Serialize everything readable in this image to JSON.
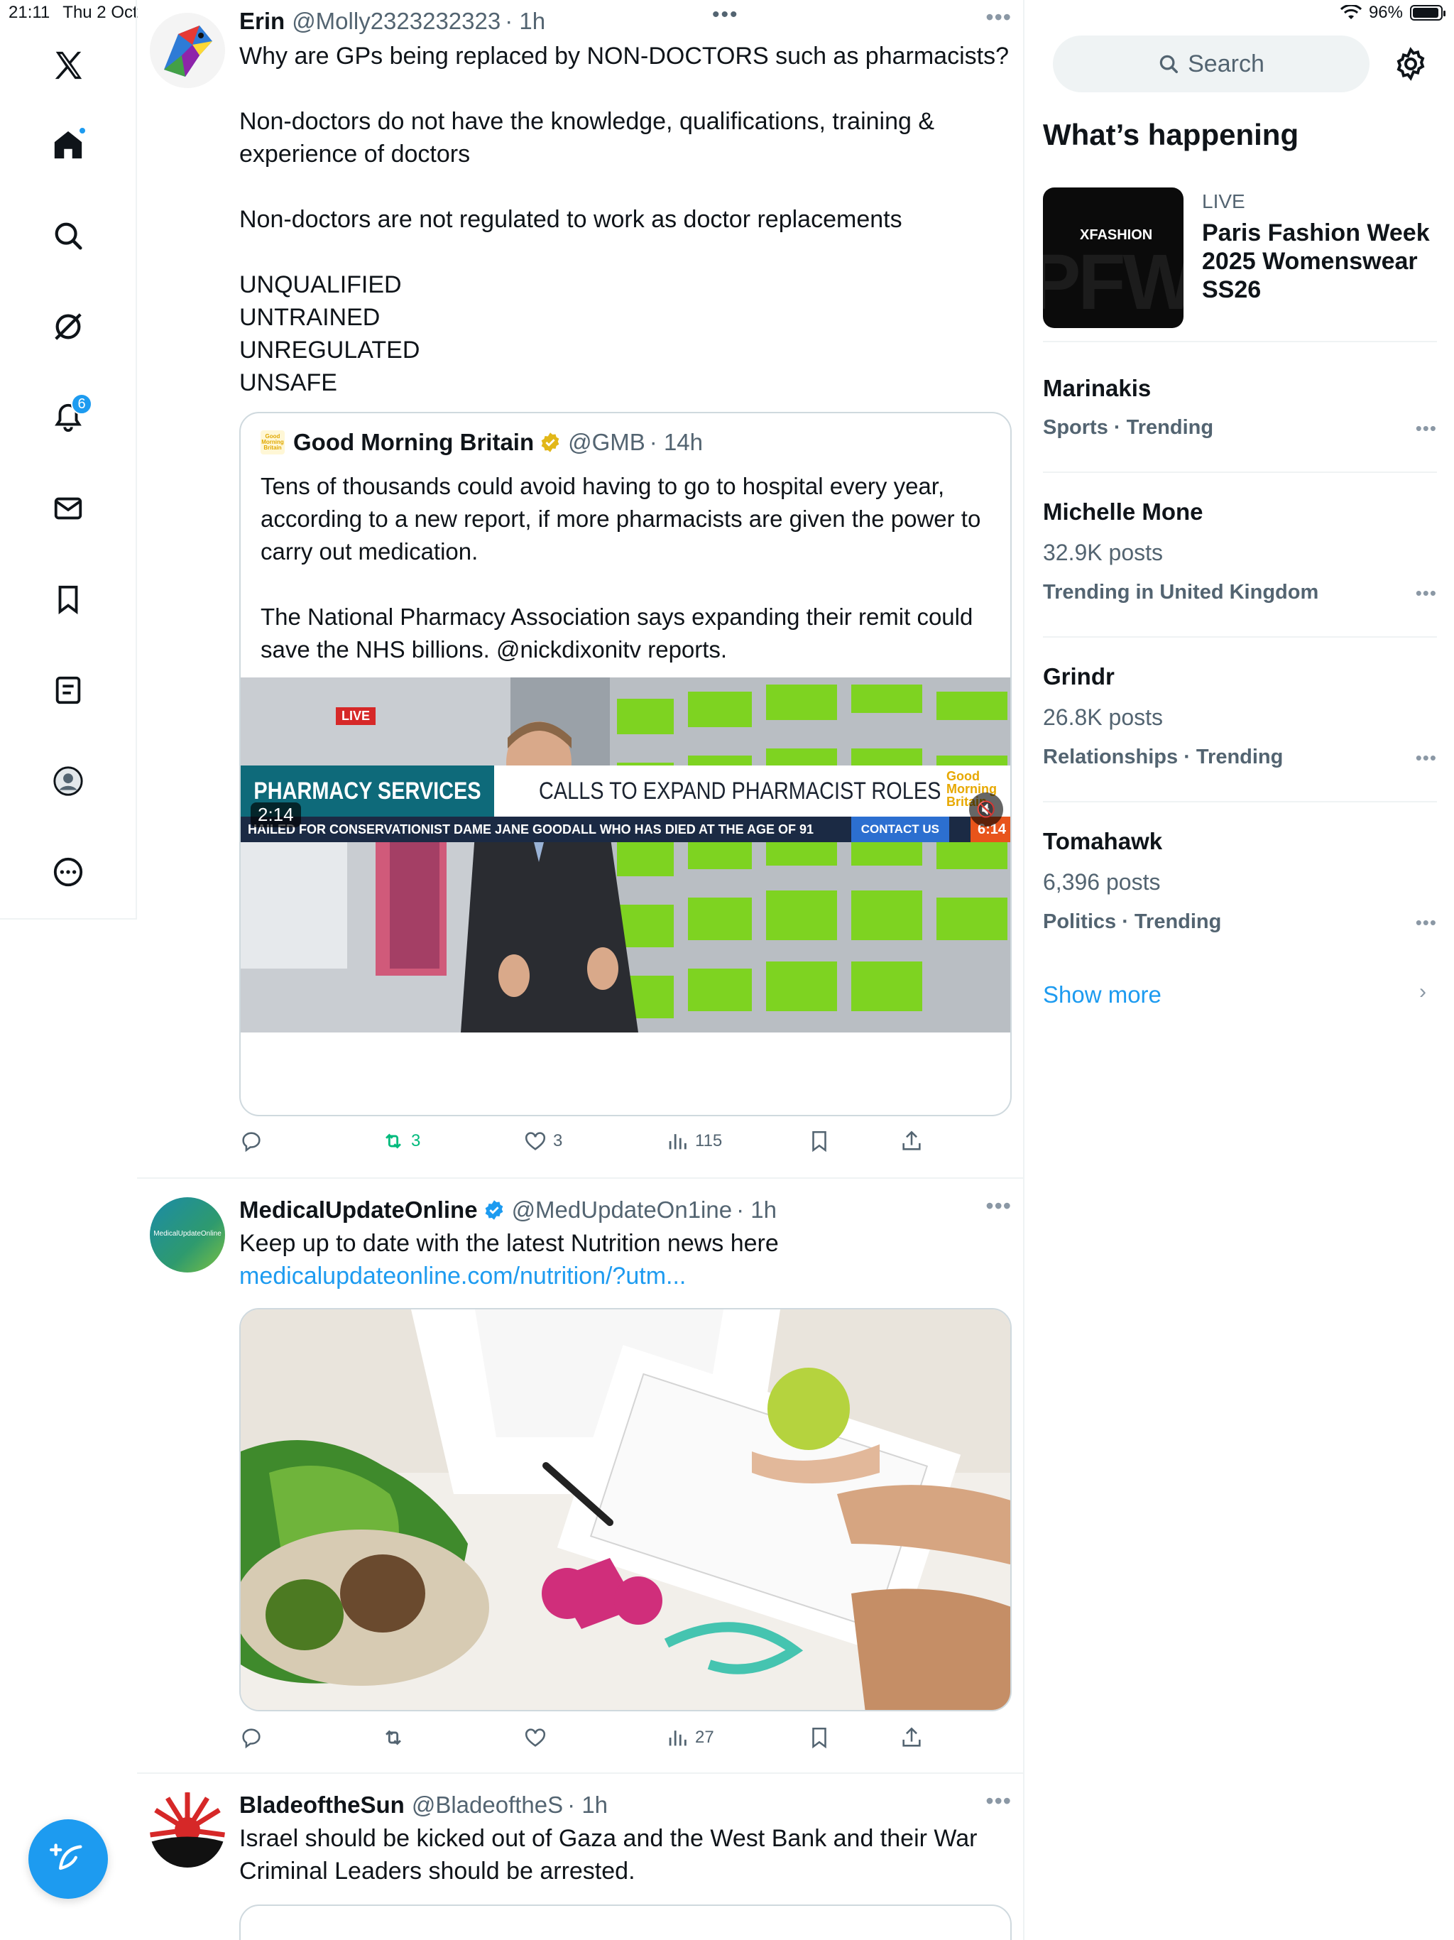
{
  "status_bar": {
    "time": "21:11",
    "date": "Thu 2 Oct",
    "battery": "96%"
  },
  "nav": {
    "notifications_count": "6"
  },
  "colors": {
    "accent": "#1d9bf0",
    "retweet_green": "#00ba7c",
    "text_secondary": "#536471"
  },
  "timeline": {
    "top_dots": "•••",
    "posts": [
      {
        "name": "Erin",
        "handle": "@Molly2323232323",
        "time": "· 1h",
        "text": "Why are GPs being replaced by NON-DOCTORS such as pharmacists?\n\nNon-doctors do not have the knowledge, qualifications, training & experience of doctors\n\nNon-doctors are not regulated to work as doctor replacements\n\nUNQUALIFIED\nUNTRAINED\nUNREGULATED\nUNSAFE",
        "quote": {
          "name": "Good Morning Britain",
          "handle": "@GMB",
          "time": "· 14h",
          "text": "Tens of thousands could avoid having to go to hospital every year, according to a new report, if more pharmacists are given the power to carry out medication.\n\nThe National Pharmacy Association says expanding their remit could save the NHS billions.   @nickdixonitv reports.",
          "video": {
            "live": "LIVE",
            "banner_left": "PHARMACY SERVICES",
            "banner_right": "CALLS TO EXPAND PHARMACIST ROLES",
            "corner_logo": "Good Morning Britain",
            "ticker": "HAILED FOR CONSERVATIONIST DAME JANE GOODALL WHO HAS DIED AT THE AGE OF 91",
            "contact": "CONTACT US",
            "clock": "6:14",
            "duration": "2:14"
          }
        },
        "actions": {
          "replies": "",
          "reposts": "3",
          "likes": "3",
          "views": "115"
        }
      },
      {
        "name": "MedicalUpdateOnline",
        "handle": "@MedUpdateOn1ine",
        "time": "· 1h",
        "text": "Keep up to date with the latest Nutrition news here",
        "link": "medicalupdateonline.com/nutrition/?utm...",
        "avatar_text": "MedicalUpdateOnline",
        "actions": {
          "replies": "",
          "reposts": "",
          "likes": "",
          "views": "27"
        }
      },
      {
        "name": "BladeoftheSun",
        "handle": "@BladeoftheS",
        "time": "· 1h",
        "text": "Israel should be kicked out of Gaza and the West Bank and their War Criminal Leaders should be arrested."
      }
    ]
  },
  "sidebar": {
    "search_placeholder": "Search",
    "section_title": "What’s happening",
    "featured": {
      "label": "LIVE",
      "title": "Paris Fashion Week 2025 Womenswear SS26",
      "image_text": "XFASHION",
      "image_bg_text": "PFW"
    },
    "trends": [
      {
        "name": "Marinakis",
        "count": "",
        "category": "Sports · Trending"
      },
      {
        "name": "Michelle Mone",
        "count": "32.9K posts",
        "category": "Trending in United Kingdom"
      },
      {
        "name": "Grindr",
        "count": "26.8K posts",
        "category": "Relationships · Trending"
      },
      {
        "name": "Tomahawk",
        "count": "6,396 posts",
        "category": "Politics · Trending"
      }
    ],
    "show_more": "Show more"
  }
}
